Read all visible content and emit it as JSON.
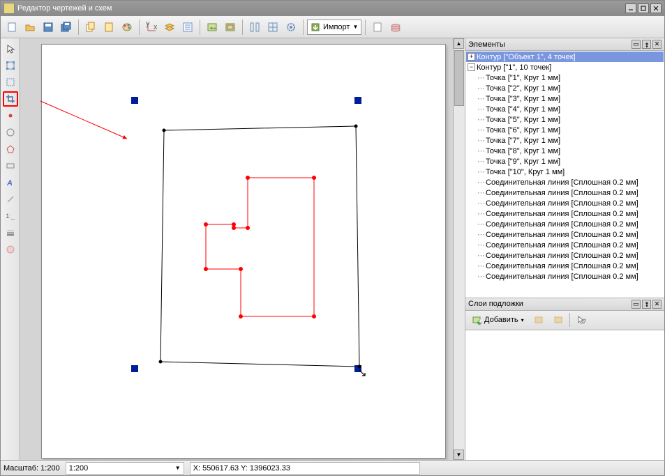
{
  "window": {
    "title": "Редактор чертежей и схем"
  },
  "toolbar": {
    "import_label": "Импорт"
  },
  "panels": {
    "elements_title": "Элементы",
    "layers_title": "Слои подложки",
    "layers_add": "Добавить"
  },
  "tree": {
    "root1": "Контур [\"Объект 1\", 4 точек]",
    "root2": "Контур [\"1\", 10 точек]",
    "points": [
      "Точка [\"1\", Круг 1 мм]",
      "Точка [\"2\", Круг 1 мм]",
      "Точка [\"3\", Круг 1 мм]",
      "Точка [\"4\", Круг 1 мм]",
      "Точка [\"5\", Круг 1 мм]",
      "Точка [\"6\", Круг 1 мм]",
      "Точка [\"7\", Круг 1 мм]",
      "Точка [\"8\", Круг 1 мм]",
      "Точка [\"9\", Круг 1 мм]",
      "Точка [\"10\", Круг 1 мм]"
    ],
    "lines": [
      "Соединительная линия [Сплошная 0.2 мм]",
      "Соединительная линия [Сплошная 0.2 мм]",
      "Соединительная линия [Сплошная 0.2 мм]",
      "Соединительная линия [Сплошная 0.2 мм]",
      "Соединительная линия [Сплошная 0.2 мм]",
      "Соединительная линия [Сплошная 0.2 мм]",
      "Соединительная линия [Сплошная 0.2 мм]",
      "Соединительная линия [Сплошная 0.2 мм]",
      "Соединительная линия [Сплошная 0.2 мм]",
      "Соединительная линия [Сплошная 0.2 мм]"
    ]
  },
  "status": {
    "scale_label": "Масштаб: 1:200",
    "scale_value": "1:200",
    "coords": "X: 550617.63 Y: 1396023.33"
  },
  "icons": {
    "new": "new-doc",
    "open": "open",
    "save": "save",
    "saveall": "save-all",
    "copy": "copy",
    "paste": "paste",
    "palette": "palette",
    "axes": "axes",
    "layers": "layers",
    "list": "list",
    "img": "image",
    "imgfit": "image-fit",
    "cols": "columns",
    "grid": "grid",
    "gear": "gear",
    "page1": "page",
    "page2": "page-stack"
  }
}
